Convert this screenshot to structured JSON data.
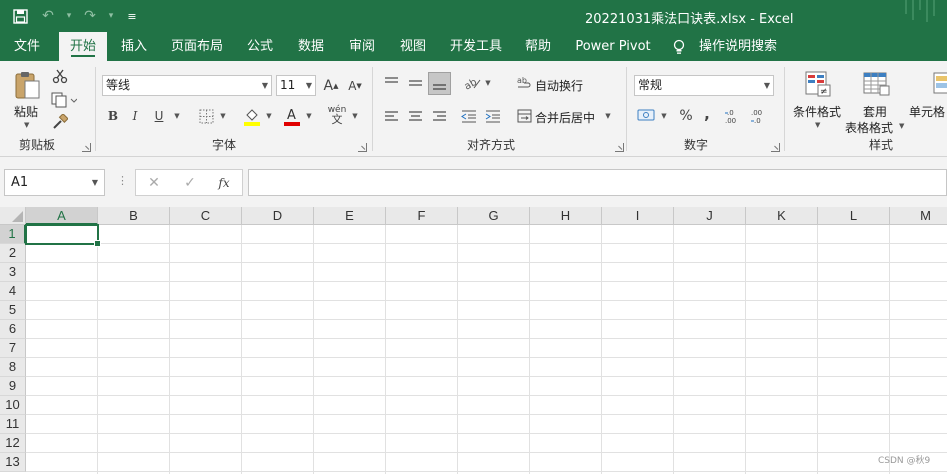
{
  "window": {
    "title": "20221031乘法口诀表.xlsx  -  Excel"
  },
  "qat": {
    "save_icon": "save-icon",
    "undo_icon": "undo-icon",
    "redo_icon": "redo-icon",
    "customize_icon": "customize-qat-icon"
  },
  "tabs": [
    {
      "label": "文件"
    },
    {
      "label": "开始"
    },
    {
      "label": "插入"
    },
    {
      "label": "页面布局"
    },
    {
      "label": "公式"
    },
    {
      "label": "数据"
    },
    {
      "label": "审阅"
    },
    {
      "label": "视图"
    },
    {
      "label": "开发工具"
    },
    {
      "label": "帮助"
    },
    {
      "label": "Power Pivot"
    },
    {
      "label": "操作说明搜索"
    }
  ],
  "ribbon": {
    "clipboard": {
      "label": "剪贴板",
      "paste": "粘贴"
    },
    "font": {
      "label": "字体",
      "font_name": "等线",
      "font_size": "11",
      "bold": "B",
      "italic": "I",
      "underline": "U",
      "phonetic": "wén"
    },
    "alignment": {
      "label": "对齐方式",
      "wrap": "自动换行",
      "merge": "合并后居中"
    },
    "number": {
      "label": "数字",
      "format": "常规",
      "percent": "%",
      "comma": ","
    },
    "styles": {
      "label": "样式",
      "conditional": "条件格式",
      "table1": "套用",
      "table2": "表格格式",
      "cell_styles": "单元格"
    }
  },
  "formula_bar": {
    "name_box": "A1",
    "fx": "fx",
    "value": ""
  },
  "sheet": {
    "columns": [
      "A",
      "B",
      "C",
      "D",
      "E",
      "F",
      "G",
      "H",
      "I",
      "J",
      "K",
      "L",
      "M"
    ],
    "rows": [
      "1",
      "2",
      "3",
      "4",
      "5",
      "6",
      "7",
      "8",
      "9",
      "10",
      "11",
      "12",
      "13"
    ],
    "active_cell": "A1"
  },
  "watermark": "CSDN @秋9",
  "colors": {
    "brand": "#217346",
    "ribbon_bg": "#f3f3f3",
    "header_bg": "#e9e9e9",
    "gridline": "#e1e1e1"
  }
}
